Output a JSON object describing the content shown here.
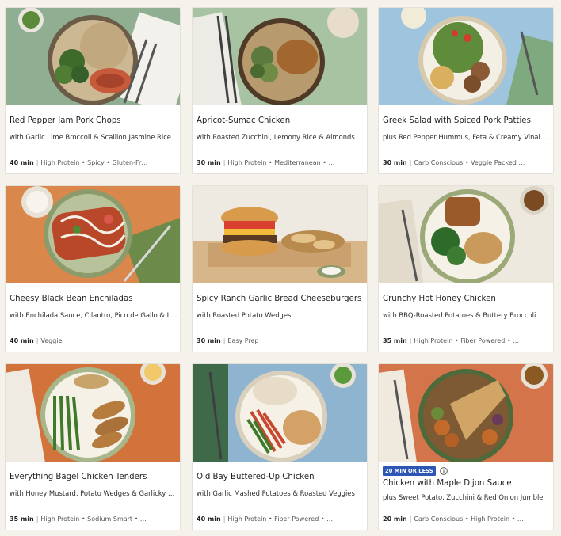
{
  "recipes": [
    {
      "title": "Red Pepper Jam Pork Chops",
      "subtitle": "with Garlic Lime Broccoli & Scallion Jasmine Rice",
      "time": "40 min",
      "tags": "High Protein • Spicy • Gluten-Fr…",
      "photo": "pork-chops-photo"
    },
    {
      "title": "Apricot-Sumac Chicken",
      "subtitle": "with Roasted Zucchini, Lemony Rice & Almonds",
      "time": "30 min",
      "tags": "High Protein • Mediterranean • …",
      "photo": "apricot-chicken-photo"
    },
    {
      "title": "Greek Salad with Spiced Pork Patties",
      "subtitle": "plus Red Pepper Hummus, Feta & Creamy Vinaigrette",
      "time": "30 min",
      "tags": "Carb Conscious • Veggie Packed …",
      "photo": "greek-salad-photo"
    },
    {
      "title": "Cheesy Black Bean Enchiladas",
      "subtitle": "with Enchilada Sauce, Cilantro, Pico de Gallo & Lim…",
      "time": "40 min",
      "tags": "Veggie",
      "photo": "enchiladas-photo"
    },
    {
      "title": "Spicy Ranch Garlic Bread Cheeseburgers",
      "subtitle": "with Roasted Potato Wedges",
      "time": "30 min",
      "tags": "Easy Prep",
      "photo": "cheeseburger-photo"
    },
    {
      "title": "Crunchy Hot Honey Chicken",
      "subtitle": "with BBQ-Roasted Potatoes & Buttery Broccoli",
      "time": "35 min",
      "tags": "High Protein • Fiber Powered • …",
      "photo": "hot-honey-chicken-photo"
    },
    {
      "title": "Everything Bagel Chicken Tenders",
      "subtitle": "with Honey Mustard, Potato Wedges & Garlicky Gre…",
      "time": "35 min",
      "tags": "High Protein • Sodium Smart • …",
      "photo": "chicken-tenders-photo"
    },
    {
      "title": "Old Bay Buttered-Up Chicken",
      "subtitle": "with Garlic Mashed Potatoes & Roasted Veggies",
      "time": "40 min",
      "tags": "High Protein • Fiber Powered • …",
      "photo": "old-bay-chicken-photo"
    },
    {
      "title": "Chicken with Maple Dijon Sauce",
      "subtitle": "plus Sweet Potato, Zucchini & Red Onion Jumble",
      "time": "20 min",
      "tags": "Carb Conscious • High Protein • …",
      "photo": "maple-dijon-chicken-photo",
      "badge": "20 MIN OR LESS"
    }
  ],
  "colors": {
    "badge": "#2c57b5",
    "card_bg": "#ffffff",
    "page_bg": "#f5f2ec"
  }
}
